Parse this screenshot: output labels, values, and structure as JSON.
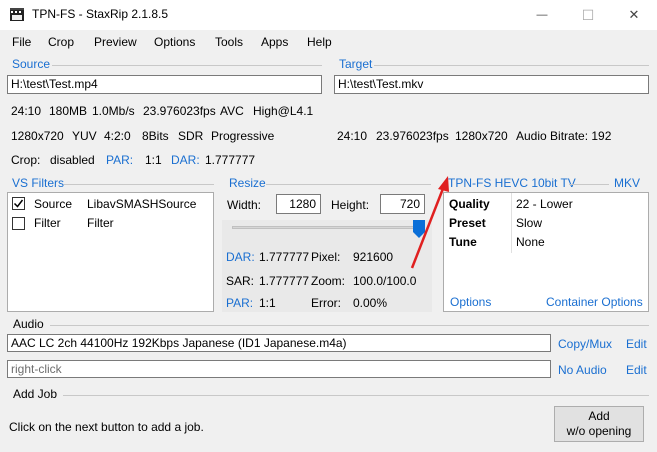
{
  "window": {
    "title": "TPN-FS - StaxRip 2.1.8.5",
    "minimize_glyph": "—",
    "maximize_glyph": "☐",
    "close_glyph": "✕"
  },
  "menu": [
    "File",
    "Crop",
    "Preview",
    "Options",
    "Tools",
    "Apps",
    "Help"
  ],
  "source": {
    "label": "Source",
    "path": "H:\\test\\Test.mp4",
    "duration": "24:10",
    "size": "180MB",
    "bitrate": "1.0Mb/s",
    "fps": "23.976023fps",
    "codec": "AVC",
    "profile": "High@L4.1",
    "resolution": "1280x720",
    "color": "YUV",
    "subsampling": "4:2:0",
    "bitdepth": "8Bits",
    "range": "SDR",
    "scan": "Progressive",
    "crop_label": "Crop:",
    "crop_value": "disabled",
    "par_label": "PAR:",
    "par_value": "1:1",
    "dar_label": "DAR:",
    "dar_value": "1.777777"
  },
  "target": {
    "label": "Target",
    "path": "H:\\test\\Test.mkv",
    "duration": "24:10",
    "fps": "23.976023fps",
    "resolution": "1280x720",
    "audio_bitrate": "Audio Bitrate: 192"
  },
  "filters": {
    "label": "VS Filters",
    "rows": [
      {
        "checked": true,
        "name": "Source",
        "value": "LibavSMASHSource"
      },
      {
        "checked": false,
        "name": "Filter",
        "value": "Filter"
      }
    ]
  },
  "resize": {
    "label": "Resize",
    "width_label": "Width:",
    "width_value": "1280",
    "height_label": "Height:",
    "height_value": "720",
    "slider_level": 1.0,
    "dar_label": "DAR:",
    "dar_value": "1.777777",
    "pixel_label": "Pixel:",
    "pixel_value": "921600",
    "sar_label": "SAR:",
    "sar_value": "1.777777",
    "zoom_label": "Zoom:",
    "zoom_value": "100.0/100.0",
    "par_label": "PAR:",
    "par_value": "1:1",
    "error_label": "Error:",
    "error_value": "0.00%"
  },
  "encoder": {
    "profile": "TPN-FS HEVC 10bit TV",
    "container": "MKV",
    "rows": [
      {
        "name": "Quality",
        "value": "22 - Lower"
      },
      {
        "name": "Preset",
        "value": "Slow"
      },
      {
        "name": "Tune",
        "value": "None"
      }
    ],
    "options_link": "Options",
    "container_options_link": "Container Options"
  },
  "audio": {
    "label": "Audio",
    "track1": "AAC LC 2ch 44100Hz 192Kbps Japanese (ID1 Japanese.m4a)",
    "track1_action": "Copy/Mux",
    "track1_edit": "Edit",
    "track2_placeholder": "right-click",
    "track2_action": "No Audio",
    "track2_edit": "Edit"
  },
  "addjob": {
    "label": "Add Job",
    "hint": "Click on the next button to add a job.",
    "button_line1": "Add",
    "button_line2": "w/o opening"
  },
  "colors": {
    "accent": "#1a6fd1",
    "annotation_arrow": "#e02020",
    "slider_thumb": "#0a6fd8"
  }
}
